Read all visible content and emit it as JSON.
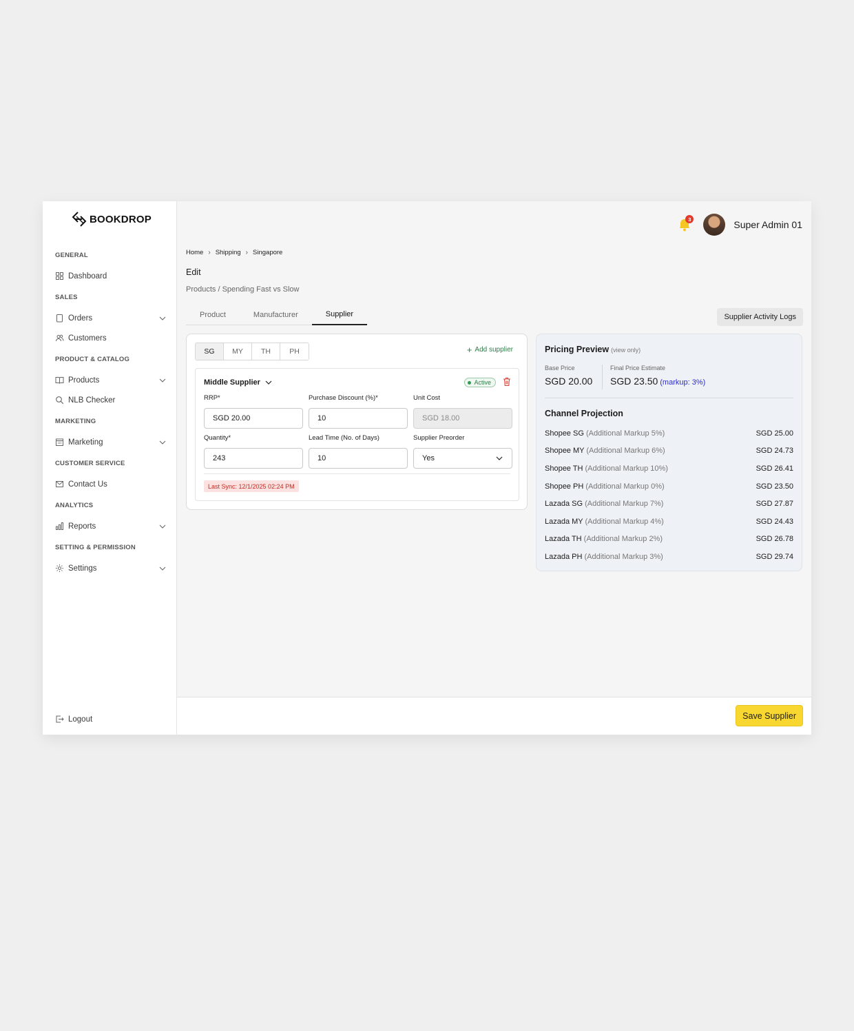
{
  "brand": {
    "name": "BOOKDROP"
  },
  "sidebar": {
    "sections": [
      {
        "heading": "GENERAL",
        "items": [
          {
            "label": "Dashboard",
            "icon": "grid-icon",
            "expandable": false
          }
        ]
      },
      {
        "heading": "SALES",
        "items": [
          {
            "label": "Orders",
            "icon": "clipboard-icon",
            "expandable": true
          },
          {
            "label": "Customers",
            "icon": "users-icon",
            "expandable": false
          }
        ]
      },
      {
        "heading": "PRODUCT & CATALOG",
        "items": [
          {
            "label": "Products",
            "icon": "book-icon",
            "expandable": true
          },
          {
            "label": "NLB Checker",
            "icon": "search-icon",
            "expandable": false
          }
        ]
      },
      {
        "heading": "MARKETING",
        "items": [
          {
            "label": "Marketing",
            "icon": "calendar-icon",
            "expandable": true
          }
        ]
      },
      {
        "heading": "CUSTOMER SERVICE",
        "items": [
          {
            "label": "Contact Us",
            "icon": "mail-icon",
            "expandable": false
          }
        ]
      },
      {
        "heading": "ANALYTICS",
        "items": [
          {
            "label": "Reports",
            "icon": "bar-chart-icon",
            "expandable": true
          }
        ]
      },
      {
        "heading": "SETTING & PERMISSION",
        "items": [
          {
            "label": "Settings",
            "icon": "gear-icon",
            "expandable": true
          }
        ]
      }
    ],
    "logout_label": "Logout"
  },
  "topbar": {
    "notification_count": "3",
    "user_name": "Super Admin 01"
  },
  "breadcrumb": [
    "Home",
    "Shipping",
    "Singapore"
  ],
  "page": {
    "title": "Edit",
    "subtitle": "Products / Spending Fast vs Slow"
  },
  "tabs": [
    {
      "label": "Product",
      "active": false
    },
    {
      "label": "Manufacturer",
      "active": false
    },
    {
      "label": "Supplier",
      "active": true
    }
  ],
  "logs_button": "Supplier Activity Logs",
  "supplier": {
    "regions": [
      {
        "label": "SG",
        "active": true
      },
      {
        "label": "MY",
        "active": false
      },
      {
        "label": "TH",
        "active": false
      },
      {
        "label": "PH",
        "active": false
      }
    ],
    "add_label": "Add supplier",
    "name": "Middle Supplier",
    "status": "Active",
    "fields": {
      "rrp": {
        "label": "RRP*",
        "value": "SGD 20.00"
      },
      "discount": {
        "label": "Purchase Discount (%)*",
        "value": "10"
      },
      "unit_cost": {
        "label": "Unit Cost",
        "value": "SGD 18.00"
      },
      "quantity": {
        "label": "Quantity*",
        "value": "243"
      },
      "lead_time": {
        "label": "Lead Time (No. of Days)",
        "value": "10"
      },
      "preorder": {
        "label": "Supplier Preorder",
        "value": "Yes"
      }
    },
    "last_sync": "Last Sync: 12/1/2025 02:24 PM"
  },
  "pricing": {
    "title": "Pricing Preview",
    "subtitle": "(view only)",
    "base_label": "Base Price",
    "base_value": "SGD 20.00",
    "final_label": "Final Price Estimate",
    "final_value": "SGD 23.50",
    "markup": "(markup: 3%)",
    "channel_title": "Channel Projection",
    "channels": [
      {
        "name": "Shopee SG",
        "note": "(Additional Markup 5%)",
        "price": "SGD 25.00"
      },
      {
        "name": "Shopee MY",
        "note": "(Additional Markup 6%)",
        "price": "SGD 24.73"
      },
      {
        "name": "Shopee TH",
        "note": "(Additional Markup 10%)",
        "price": "SGD 26.41"
      },
      {
        "name": "Shopee PH",
        "note": "(Additional Markup 0%)",
        "price": "SGD 23.50"
      },
      {
        "name": "Lazada SG",
        "note": "(Additional Markup 7%)",
        "price": "SGD 27.87"
      },
      {
        "name": "Lazada MY",
        "note": "(Additional Markup 4%)",
        "price": "SGD 24.43"
      },
      {
        "name": "Lazada TH",
        "note": "(Additional Markup 2%)",
        "price": "SGD 26.78"
      },
      {
        "name": "Lazada PH",
        "note": "(Additional Markup 3%)",
        "price": "SGD 29.74"
      }
    ]
  },
  "footer": {
    "save_label": "Save Supplier"
  },
  "colors": {
    "accent": "#F8D731",
    "active_green": "#2E7D4A",
    "danger": "#D9453A",
    "markup_blue": "#2B2BD6"
  }
}
